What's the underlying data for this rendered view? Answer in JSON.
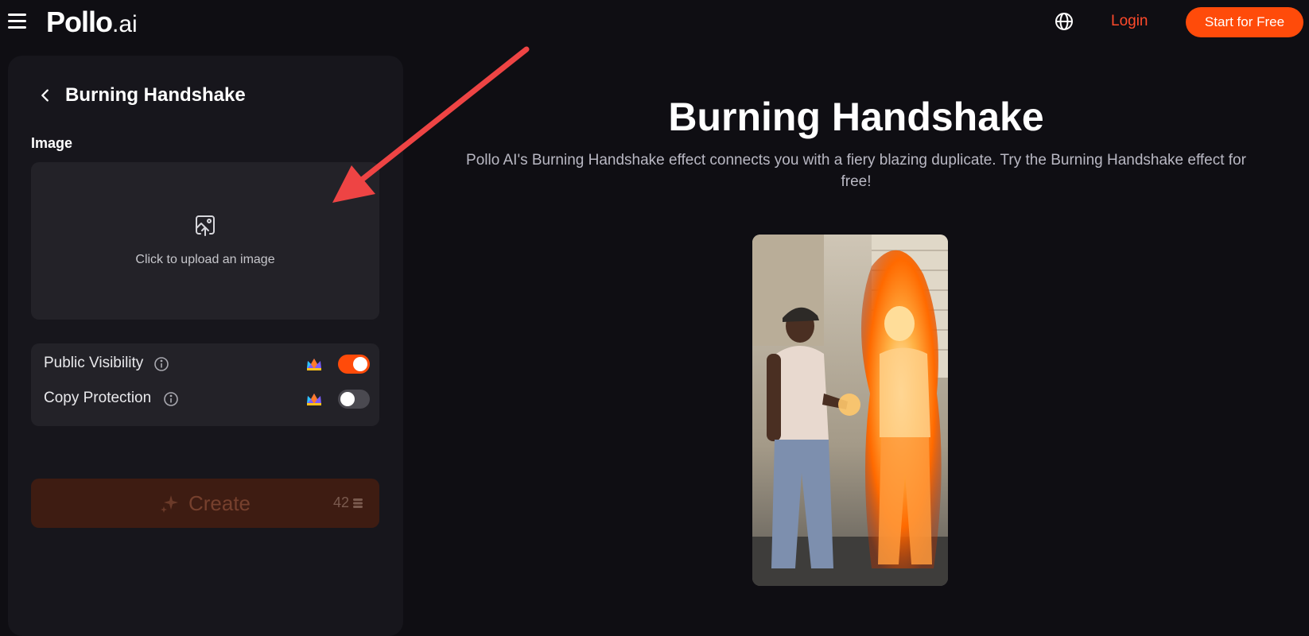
{
  "header": {
    "logo_main": "Pollo",
    "logo_suffix": ".ai",
    "login_label": "Login",
    "start_label": "Start for Free",
    "accent_color": "#ff4b0a"
  },
  "panel": {
    "title": "Burning Handshake",
    "image_label": "Image",
    "upload_text": "Click to upload an image",
    "settings": [
      {
        "label": "Public Visibility",
        "enabled": true
      },
      {
        "label": "Copy Protection",
        "enabled": false
      }
    ],
    "create_label": "Create",
    "credits": "42"
  },
  "main": {
    "title": "Burning Handshake",
    "description": "Pollo AI's Burning Handshake effect connects you with a fiery blazing duplicate. Try the Burning Handshake effect for free!"
  }
}
